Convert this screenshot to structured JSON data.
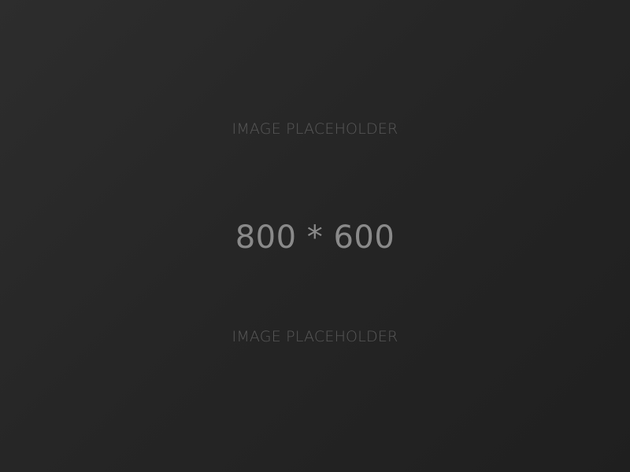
{
  "placeholder": {
    "caption_top": "IMAGE PLACEHOLDER",
    "dimensions": "800 * 600",
    "caption_bottom": "IMAGE PLACEHOLDER"
  },
  "colors": {
    "background_light": "#2d2d2d",
    "background_dark": "#1f1f1f",
    "caption_text": "#595959",
    "dimensions_text": "#8a8a8a"
  }
}
